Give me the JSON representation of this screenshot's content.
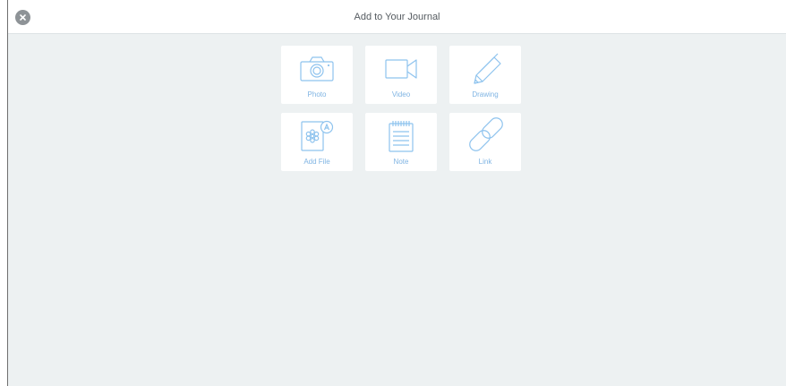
{
  "header": {
    "title": "Add to Your Journal",
    "close_icon": "close-icon"
  },
  "colors": {
    "accent": "#8ec3ee",
    "label": "#7fb4e3",
    "background": "#edf1f2",
    "close_button": "#8e9397"
  },
  "options": [
    {
      "label": "Photo",
      "icon": "camera-icon"
    },
    {
      "label": "Video",
      "icon": "video-camera-icon"
    },
    {
      "label": "Drawing",
      "icon": "pencil-icon"
    },
    {
      "label": "Add File",
      "icon": "file-icon"
    },
    {
      "label": "Note",
      "icon": "notepad-icon"
    },
    {
      "label": "Link",
      "icon": "link-icon"
    }
  ]
}
